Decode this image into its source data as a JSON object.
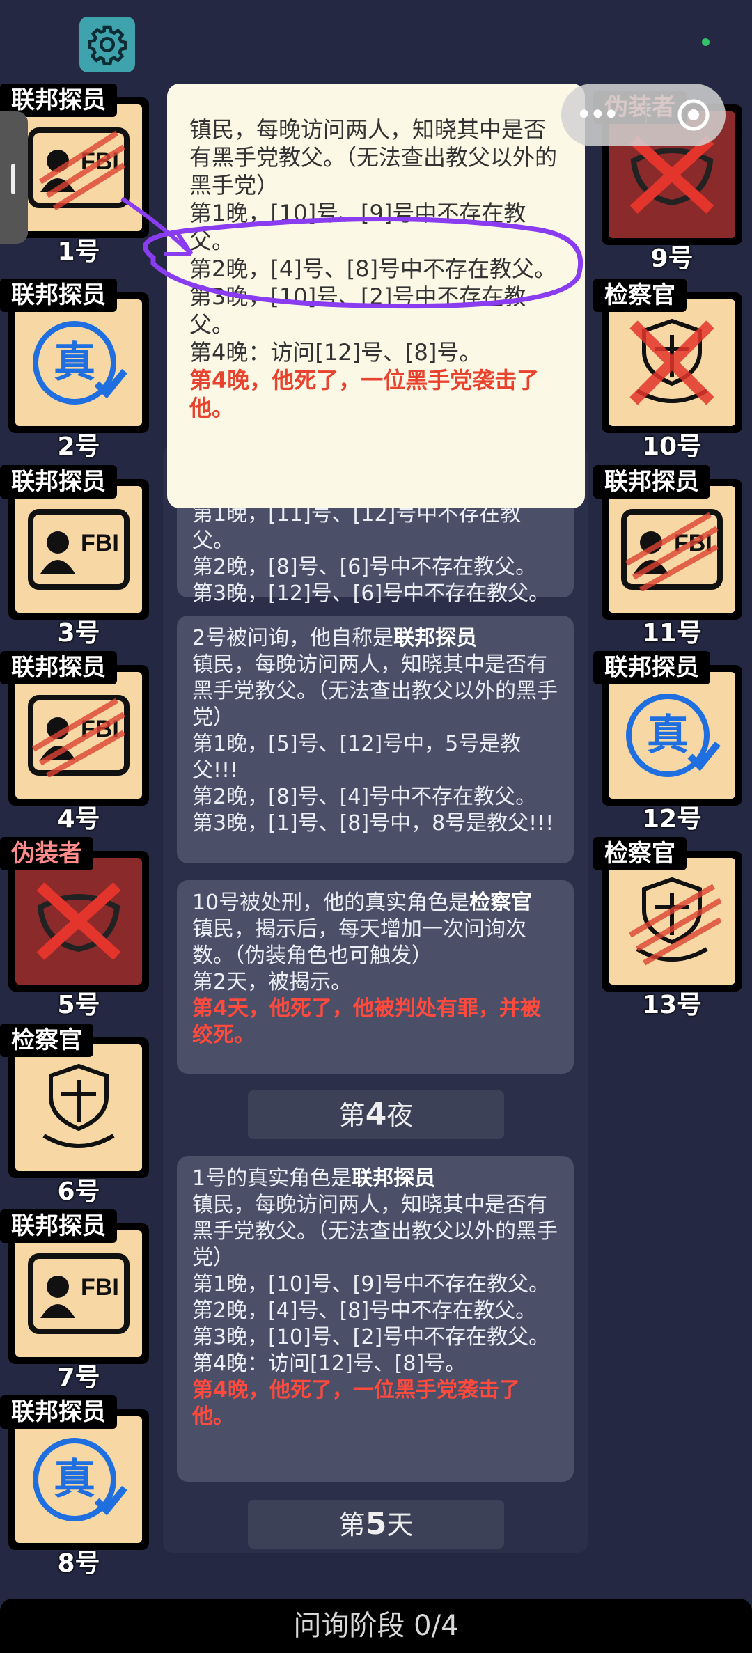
{
  "popup": {
    "desc": "镇民，每晚访问两人，知晓其中是否有黑手党教父。（无法查出教父以外的黑手党）",
    "line1": "第1晚，[10]号、[9]号中不存在教父。",
    "line2": "第2晚，[4]号、[8]号中不存在教父。",
    "line3": "第3晚，[10]号、[2]号中不存在教父。",
    "line4": "第4晚：访问[12]号、[8]号。",
    "death": "第4晚，他死了，一位黑手党袭击了他。"
  },
  "players_left": [
    {
      "role": "联邦探员",
      "num": "1号",
      "icon": "fbi-badge-icon",
      "dead": true
    },
    {
      "role": "联邦探员",
      "num": "2号",
      "icon": "true-stamp-icon",
      "dead": false
    },
    {
      "role": "联邦探员",
      "num": "3号",
      "icon": "fbi-badge-icon",
      "dead": false
    },
    {
      "role": "联邦探员",
      "num": "4号",
      "icon": "fbi-badge-icon",
      "dead": true
    },
    {
      "role": "伪装者",
      "num": "5号",
      "icon": "mask-icon",
      "dead": true
    },
    {
      "role": "检察官",
      "num": "6号",
      "icon": "scales-icon",
      "dead": false
    },
    {
      "role": "联邦探员",
      "num": "7号",
      "icon": "fbi-badge-icon",
      "dead": false
    },
    {
      "role": "联邦探员",
      "num": "8号",
      "icon": "true-stamp-icon",
      "dead": false
    }
  ],
  "players_right": [
    {
      "role": "伪装者",
      "num": "9号",
      "icon": "mask-icon",
      "dead": true
    },
    {
      "role": "检察官",
      "num": "10号",
      "icon": "scales-icon",
      "dead": true
    },
    {
      "role": "联邦探员",
      "num": "11号",
      "icon": "fbi-badge-icon",
      "dead": true
    },
    {
      "role": "联邦探员",
      "num": "12号",
      "icon": "true-stamp-icon",
      "dead": false
    },
    {
      "role": "检察官",
      "num": "13号",
      "icon": "scales-icon",
      "dead": true
    }
  ],
  "feed": {
    "msg0": {
      "l1": "第1晚，[11]号、[12]号中不存在教父。",
      "l2": "第2晚，[8]号、[6]号中不存在教父。",
      "l3": "第3晚，[12]号、[6]号中不存在教父。"
    },
    "msg1": {
      "head_a": "2号被问询，他自称是",
      "head_b": "联邦探员",
      "desc": "镇民，每晚访问两人，知晓其中是否有黑手党教父。（无法查出教父以外的黑手党）",
      "l1": "第1晚，[5]号、[12]号中，5号是教父!!!",
      "l2": "第2晚，[8]号、[4]号中不存在教父。",
      "l3": "第3晚，[1]号、[8]号中，8号是教父!!!"
    },
    "msg2": {
      "head_a": "10号被处刑，他的真实角色是",
      "head_b": "检察官",
      "desc": "镇民，揭示后，每天增加一次问询次数。（伪装角色也可触发）",
      "l1": "第2天，被揭示。",
      "death": "第4天，他死了，他被判处有罪，并被绞死。"
    },
    "phase1_pre": "第",
    "phase1_num": "4",
    "phase1_post": "夜",
    "msg3": {
      "head_a": "1号的真实角色是",
      "head_b": "联邦探员",
      "desc": "镇民，每晚访问两人，知晓其中是否有黑手党教父。（无法查出教父以外的黑手党）",
      "l1": "第1晚，[10]号、[9]号中不存在教父。",
      "l2": "第2晚，[4]号、[8]号中不存在教父。",
      "l3": "第3晚，[10]号、[2]号中不存在教父。",
      "l4": "第4晚：访问[12]号、[8]号。",
      "death": "第4晚，他死了，一位黑手党袭击了他。"
    },
    "phase2_pre": "第",
    "phase2_num": "5",
    "phase2_post": "天"
  },
  "bottom_status": "问询阶段 0/4",
  "colors": {
    "accent_red": "#ff4a3d",
    "card_bg": "#f7d8a4",
    "true_blue": "#1f6fe0",
    "scribble": "#8a3cf0"
  }
}
